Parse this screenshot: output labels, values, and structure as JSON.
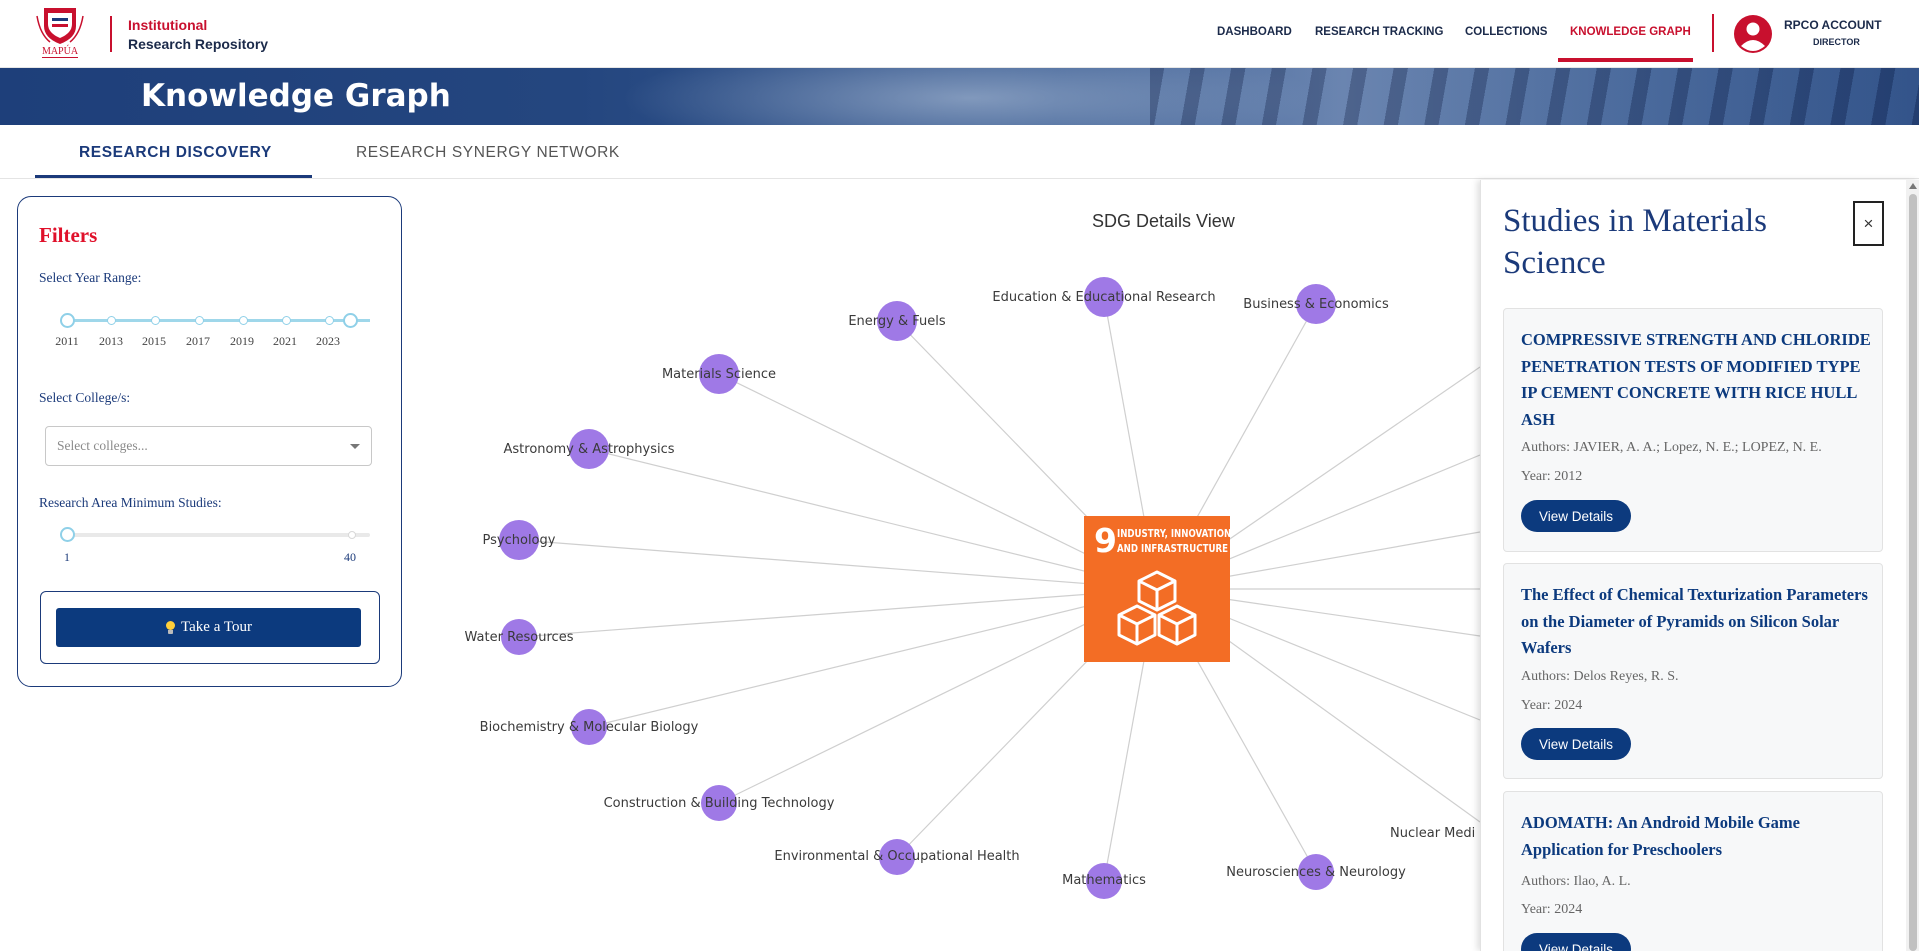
{
  "header": {
    "logo_text": "MAPÚA",
    "brand_line1": "Institutional",
    "brand_line2": "Research Repository",
    "nav": [
      {
        "label": "DASHBOARD"
      },
      {
        "label": "RESEARCH TRACKING"
      },
      {
        "label": "COLLECTIONS"
      },
      {
        "label": "KNOWLEDGE GRAPH"
      }
    ],
    "active_nav": "KNOWLEDGE GRAPH",
    "account_name": "RPCO ACCOUNT",
    "account_role": "DIRECTOR"
  },
  "banner": {
    "title": "Knowledge Graph"
  },
  "tabs": [
    {
      "label": "RESEARCH DISCOVERY",
      "active": true
    },
    {
      "label": "RESEARCH SYNERGY NETWORK",
      "active": false
    }
  ],
  "filters": {
    "title": "Filters",
    "year_label": "Select Year Range:",
    "year_marks": [
      "2011",
      "2013",
      "2015",
      "2017",
      "2019",
      "2021",
      "2023"
    ],
    "year_range_selected": [
      "2011",
      "2024"
    ],
    "college_label": "Select College/s:",
    "college_placeholder": "Select colleges...",
    "min_label": "Research Area Minimum Studies:",
    "min_value": "1",
    "max_value": "40",
    "tour_button": "Take a Tour"
  },
  "graph": {
    "title": "SDG Details View",
    "center": {
      "number": "9",
      "line1": "INDUSTRY, INNOVATION",
      "line2": "AND INFRASTRUCTURE",
      "color": "#f36d25"
    },
    "node_color": "#9f79e6",
    "nodes": [
      {
        "label": "Education & Educational Research"
      },
      {
        "label": "Business & Economics"
      },
      {
        "label": "Energy & Fuels"
      },
      {
        "label": "Materials Science"
      },
      {
        "label": "Astronomy & Astrophysics"
      },
      {
        "label": "Psychology"
      },
      {
        "label": "Water Resources"
      },
      {
        "label": "Biochemistry & Molecular Biology"
      },
      {
        "label": "Construction & Building Technology"
      },
      {
        "label": "Environmental & Occupational Health"
      },
      {
        "label": "Mathematics"
      },
      {
        "label": "Neurosciences & Neurology"
      },
      {
        "label": "Nuclear Medi"
      }
    ]
  },
  "panel": {
    "title": "Studies in Materials Science",
    "close_label": "×",
    "studies": [
      {
        "title": "COMPRESSIVE STRENGTH AND CHLORIDE PENETRATION TESTS OF MODIFIED TYPE IP CEMENT CONCRETE WITH RICE HULL ASH",
        "authors": "Authors: JAVIER, A. A.; Lopez, N. E.; LOPEZ, N. E.",
        "year": "Year: 2012",
        "button": "View Details"
      },
      {
        "title": "The Effect of Chemical Texturization Parameters on the Diameter of Pyramids on Silicon Solar Wafers",
        "authors": "Authors: Delos Reyes, R. S.",
        "year": "Year: 2024",
        "button": "View Details"
      },
      {
        "title": "ADOMATH: An Android Mobile Game Application for Preschoolers",
        "authors": "Authors: Ilao, A. L.",
        "year": "Year: 2024",
        "button": "View Details"
      }
    ]
  },
  "colors": {
    "brand_red": "#c8102e",
    "brand_navy": "#1b3a7a",
    "button_navy": "#0c3a7e"
  }
}
